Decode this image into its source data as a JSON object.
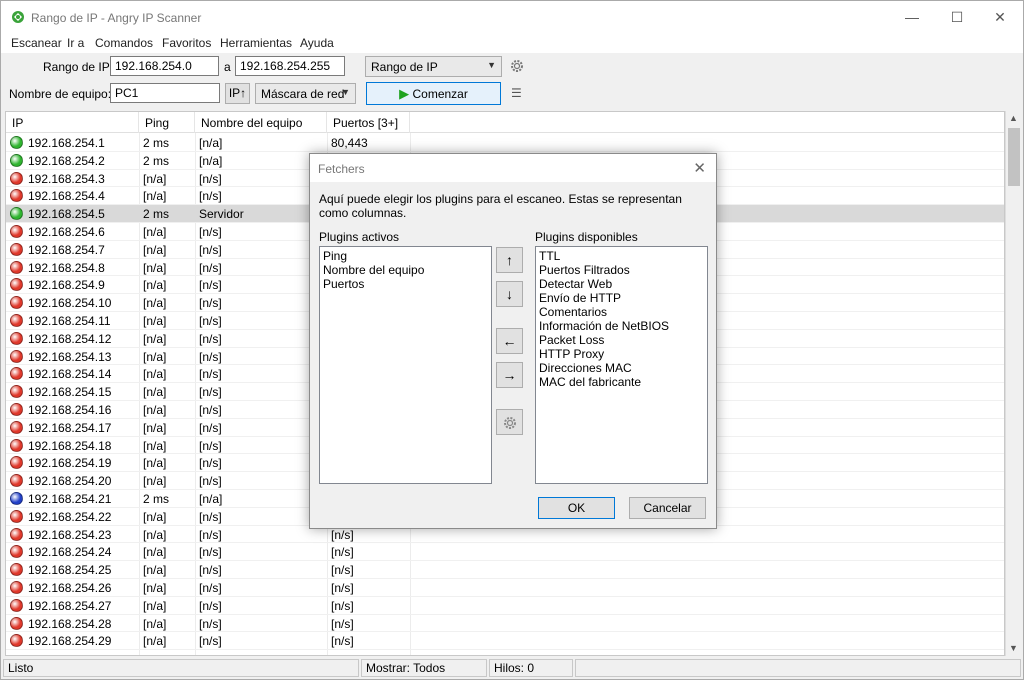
{
  "window": {
    "title": "Rango de IP - Angry IP Scanner",
    "controls": {
      "minimize": "—",
      "maximize": "☐",
      "close": "✕"
    }
  },
  "menu": [
    "Escanear",
    "Ir a",
    "Comandos",
    "Favoritos",
    "Herramientas",
    "Ayuda"
  ],
  "toolbar": {
    "range_label": "Rango de IP:",
    "ip_from": "192.168.254.0",
    "to_label": "a",
    "ip_to": "192.168.254.255",
    "feeder_select": "Rango de IP",
    "hostname_label": "Nombre de equipo:",
    "hostname_value": "PC1",
    "ip_up_button": "IP↑",
    "netmask_select": "Máscara de red",
    "start_button": "Comenzar",
    "start_icon_color": "#1fa21f"
  },
  "table": {
    "columns": [
      "IP",
      "Ping",
      "Nombre del equipo",
      "Puertos [3+]"
    ],
    "rows": [
      {
        "ip": "192.168.254.1",
        "ping": "2 ms",
        "name": "[n/a]",
        "ports": "80,443",
        "status": "alive"
      },
      {
        "ip": "192.168.254.2",
        "ping": "2 ms",
        "name": "[n/a]",
        "ports": "",
        "status": "alive"
      },
      {
        "ip": "192.168.254.3",
        "ping": "[n/a]",
        "name": "[n/s]",
        "ports": "",
        "status": "dead"
      },
      {
        "ip": "192.168.254.4",
        "ping": "[n/a]",
        "name": "[n/s]",
        "ports": "",
        "status": "dead"
      },
      {
        "ip": "192.168.254.5",
        "ping": "2 ms",
        "name": "Servidor",
        "ports": "",
        "status": "alive",
        "selected": true
      },
      {
        "ip": "192.168.254.6",
        "ping": "[n/a]",
        "name": "[n/s]",
        "ports": "",
        "status": "dead"
      },
      {
        "ip": "192.168.254.7",
        "ping": "[n/a]",
        "name": "[n/s]",
        "ports": "",
        "status": "dead"
      },
      {
        "ip": "192.168.254.8",
        "ping": "[n/a]",
        "name": "[n/s]",
        "ports": "",
        "status": "dead"
      },
      {
        "ip": "192.168.254.9",
        "ping": "[n/a]",
        "name": "[n/s]",
        "ports": "",
        "status": "dead"
      },
      {
        "ip": "192.168.254.10",
        "ping": "[n/a]",
        "name": "[n/s]",
        "ports": "",
        "status": "dead"
      },
      {
        "ip": "192.168.254.11",
        "ping": "[n/a]",
        "name": "[n/s]",
        "ports": "",
        "status": "dead"
      },
      {
        "ip": "192.168.254.12",
        "ping": "[n/a]",
        "name": "[n/s]",
        "ports": "",
        "status": "dead"
      },
      {
        "ip": "192.168.254.13",
        "ping": "[n/a]",
        "name": "[n/s]",
        "ports": "",
        "status": "dead"
      },
      {
        "ip": "192.168.254.14",
        "ping": "[n/a]",
        "name": "[n/s]",
        "ports": "",
        "status": "dead"
      },
      {
        "ip": "192.168.254.15",
        "ping": "[n/a]",
        "name": "[n/s]",
        "ports": "",
        "status": "dead"
      },
      {
        "ip": "192.168.254.16",
        "ping": "[n/a]",
        "name": "[n/s]",
        "ports": "",
        "status": "dead"
      },
      {
        "ip": "192.168.254.17",
        "ping": "[n/a]",
        "name": "[n/s]",
        "ports": "",
        "status": "dead"
      },
      {
        "ip": "192.168.254.18",
        "ping": "[n/a]",
        "name": "[n/s]",
        "ports": "",
        "status": "dead"
      },
      {
        "ip": "192.168.254.19",
        "ping": "[n/a]",
        "name": "[n/s]",
        "ports": "",
        "status": "dead"
      },
      {
        "ip": "192.168.254.20",
        "ping": "[n/a]",
        "name": "[n/s]",
        "ports": "",
        "status": "dead"
      },
      {
        "ip": "192.168.254.21",
        "ping": "2 ms",
        "name": "[n/a]",
        "ports": "",
        "status": "info"
      },
      {
        "ip": "192.168.254.22",
        "ping": "[n/a]",
        "name": "[n/s]",
        "ports": "",
        "status": "dead"
      },
      {
        "ip": "192.168.254.23",
        "ping": "[n/a]",
        "name": "[n/s]",
        "ports": "[n/s]",
        "status": "dead"
      },
      {
        "ip": "192.168.254.24",
        "ping": "[n/a]",
        "name": "[n/s]",
        "ports": "[n/s]",
        "status": "dead"
      },
      {
        "ip": "192.168.254.25",
        "ping": "[n/a]",
        "name": "[n/s]",
        "ports": "[n/s]",
        "status": "dead"
      },
      {
        "ip": "192.168.254.26",
        "ping": "[n/a]",
        "name": "[n/s]",
        "ports": "[n/s]",
        "status": "dead"
      },
      {
        "ip": "192.168.254.27",
        "ping": "[n/a]",
        "name": "[n/s]",
        "ports": "[n/s]",
        "status": "dead"
      },
      {
        "ip": "192.168.254.28",
        "ping": "[n/a]",
        "name": "[n/s]",
        "ports": "[n/s]",
        "status": "dead"
      },
      {
        "ip": "192.168.254.29",
        "ping": "[n/a]",
        "name": "[n/s]",
        "ports": "[n/s]",
        "status": "dead"
      }
    ],
    "status_colors": {
      "alive": "#2fb52f",
      "dead": "#e0382b",
      "info": "#2240c8"
    }
  },
  "statusbar": {
    "state": "Listo",
    "display": "Mostrar: Todos",
    "threads": "Hilos: 0"
  },
  "dialog": {
    "title": "Fetchers",
    "description": "Aquí puede elegir los plugins para el escaneo. Estas se representan como columnas.",
    "active_label": "Plugins activos",
    "available_label": "Plugins disponibles",
    "active": [
      "Ping",
      "Nombre del equipo",
      "Puertos"
    ],
    "available": [
      "TTL",
      "Puertos Filtrados",
      "Detectar Web",
      "Envío de HTTP",
      "Comentarios",
      "Información de NetBIOS",
      "Packet Loss",
      "HTTP Proxy",
      "Direcciones MAC",
      "MAC del fabricante"
    ],
    "buttons": {
      "up": "↑",
      "down": "↓",
      "left": "←",
      "right": "→",
      "ok": "OK",
      "cancel": "Cancelar"
    }
  }
}
